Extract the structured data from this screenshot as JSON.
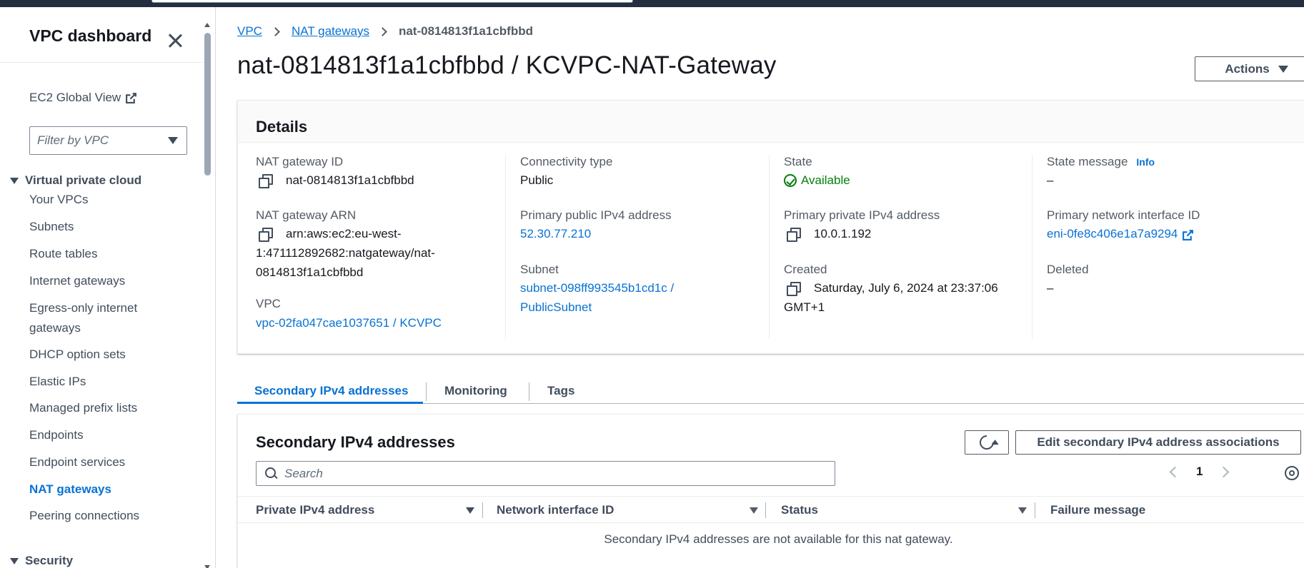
{
  "sidebar": {
    "title": "VPC dashboard",
    "ec2_global_view": "EC2 Global View",
    "filter_placeholder": "Filter by VPC",
    "section_vpc": "Virtual private cloud",
    "items": [
      {
        "label": "Your VPCs"
      },
      {
        "label": "Subnets"
      },
      {
        "label": "Route tables"
      },
      {
        "label": "Internet gateways"
      },
      {
        "label": "Egress-only internet gateways"
      },
      {
        "label": "DHCP option sets"
      },
      {
        "label": "Elastic IPs"
      },
      {
        "label": "Managed prefix lists"
      },
      {
        "label": "Endpoints"
      },
      {
        "label": "Endpoint services"
      },
      {
        "label": "NAT gateways",
        "active": true
      },
      {
        "label": "Peering connections"
      }
    ],
    "section_security": "Security"
  },
  "breadcrumb": {
    "vpc": "VPC",
    "nat_gateways": "NAT gateways",
    "current": "nat-0814813f1a1cbfbbd"
  },
  "page_title": "nat-0814813f1a1cbfbbd / KCVPC-NAT-Gateway",
  "actions_label": "Actions",
  "details": {
    "heading": "Details",
    "nat_gateway_id_label": "NAT gateway ID",
    "nat_gateway_id": "nat-0814813f1a1cbfbbd",
    "nat_gateway_arn_label": "NAT gateway ARN",
    "nat_gateway_arn_line1": "arn:aws:ec2:eu-west-",
    "nat_gateway_arn_line2": "1:471112892682:natgateway/nat-",
    "nat_gateway_arn_line3": "0814813f1a1cbfbbd",
    "vpc_label": "VPC",
    "vpc": "vpc-02fa047cae1037651 / KCVPC",
    "connectivity_type_label": "Connectivity type",
    "connectivity_type": "Public",
    "primary_public_ipv4_label": "Primary public IPv4 address",
    "primary_public_ipv4": "52.30.77.210",
    "subnet_label": "Subnet",
    "subnet_line1": "subnet-098ff993545b1cd1c /",
    "subnet_line2": "PublicSubnet",
    "state_label": "State",
    "state": "Available",
    "primary_private_ipv4_label": "Primary private IPv4 address",
    "primary_private_ipv4": "10.0.1.192",
    "created_label": "Created",
    "created_line1": "Saturday, July 6, 2024 at 23:37:06",
    "created_line2": "GMT+1",
    "state_message_label": "State message",
    "info_label": "Info",
    "state_message": "–",
    "primary_eni_label": "Primary network interface ID",
    "primary_eni": "eni-0fe8c406e1a7a9294",
    "deleted_label": "Deleted",
    "deleted": "–"
  },
  "tabs": [
    {
      "label": "Secondary IPv4 addresses",
      "active": true
    },
    {
      "label": "Monitoring"
    },
    {
      "label": "Tags"
    }
  ],
  "secondary": {
    "title": "Secondary IPv4 addresses",
    "edit_label": "Edit secondary IPv4 address associations",
    "search_placeholder": "Search",
    "page": "1",
    "columns": [
      "Private IPv4 address",
      "Network interface ID",
      "Status",
      "Failure message"
    ],
    "empty_message": "Secondary IPv4 addresses are not available for this nat gateway."
  },
  "colors": {
    "link": "#0972d3",
    "success": "#037f0c",
    "topbar": "#232f3e"
  }
}
